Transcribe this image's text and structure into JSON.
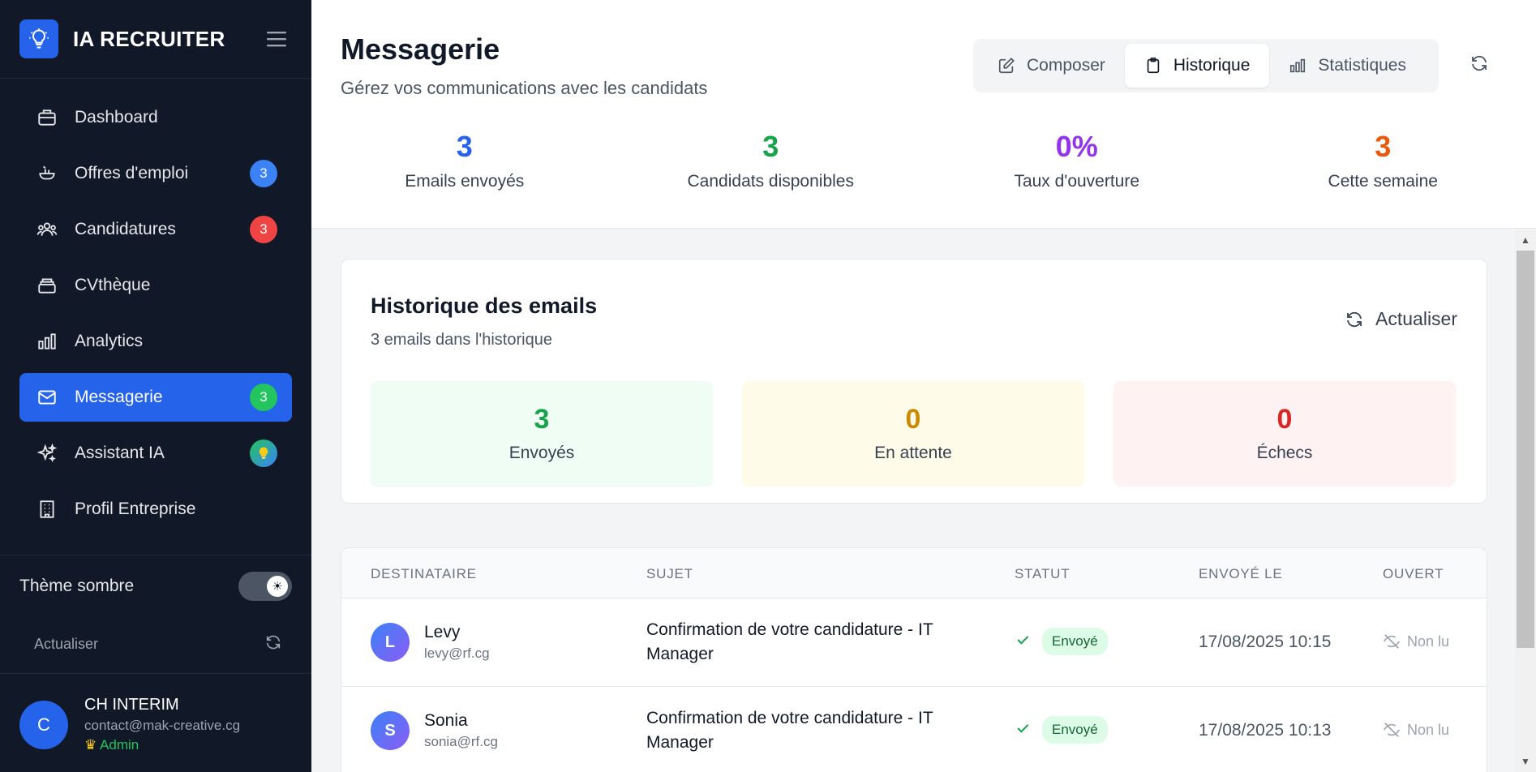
{
  "brand": {
    "name": "IA RECRUITER"
  },
  "sidebar": {
    "items": [
      {
        "label": "Dashboard",
        "icon": "briefcase-icon"
      },
      {
        "label": "Offres d'emploi",
        "icon": "pan-icon",
        "badge": "3",
        "badge_color": "#3b82f6"
      },
      {
        "label": "Candidatures",
        "icon": "users-icon",
        "badge": "3",
        "badge_color": "#ef4444"
      },
      {
        "label": "CVthèque",
        "icon": "archive-icon"
      },
      {
        "label": "Analytics",
        "icon": "bar-chart-icon"
      },
      {
        "label": "Messagerie",
        "icon": "mail-icon",
        "badge": "3",
        "badge_color": "#22c55e",
        "active": true
      },
      {
        "label": "Assistant IA",
        "icon": "sparkles-icon",
        "badge_icon": "lightbulb-icon"
      },
      {
        "label": "Profil Entreprise",
        "icon": "building-icon"
      }
    ],
    "theme_label": "Thème sombre",
    "refresh_label": "Actualiser",
    "user": {
      "initial": "C",
      "name": "CH INTERIM",
      "email": "contact@mak-creative.cg",
      "role": "Admin"
    }
  },
  "header": {
    "title": "Messagerie",
    "subtitle": "Gérez vos communications avec les candidats",
    "tabs": [
      {
        "label": "Composer",
        "icon": "edit-icon"
      },
      {
        "label": "Historique",
        "icon": "clipboard-icon",
        "active": true
      },
      {
        "label": "Statistiques",
        "icon": "bar-chart-icon"
      }
    ],
    "stats": [
      {
        "value": "3",
        "label": "Emails envoyés",
        "color": "#2563eb"
      },
      {
        "value": "3",
        "label": "Candidats disponibles",
        "color": "#16a34a"
      },
      {
        "value": "0%",
        "label": "Taux d'ouverture",
        "color": "#9333ea"
      },
      {
        "value": "3",
        "label": "Cette semaine",
        "color": "#ea580c"
      }
    ]
  },
  "history": {
    "title": "Historique des emails",
    "subtitle": "3 emails dans l'historique",
    "refresh_label": "Actualiser",
    "summary": [
      {
        "value": "3",
        "label": "Envoyés",
        "color": "#16a34a",
        "bg": "#f0fdf4"
      },
      {
        "value": "0",
        "label": "En attente",
        "color": "#ca8a04",
        "bg": "#fefce8"
      },
      {
        "value": "0",
        "label": "Échecs",
        "color": "#dc2626",
        "bg": "#fef2f2"
      }
    ]
  },
  "table": {
    "headers": [
      "DESTINATAIRE",
      "SUJET",
      "STATUT",
      "ENVOYÉ LE",
      "OUVERT"
    ],
    "rows": [
      {
        "initial": "L",
        "name": "Levy",
        "email": "levy@rf.cg",
        "subject": "Confirmation de votre candidature - IT Manager",
        "status": "Envoyé",
        "date": "17/08/2025 10:15",
        "opened": "Non lu"
      },
      {
        "initial": "S",
        "name": "Sonia",
        "email": "sonia@rf.cg",
        "subject": "Confirmation de votre candidature - IT Manager",
        "status": "Envoyé",
        "date": "17/08/2025 10:13",
        "opened": "Non lu"
      }
    ]
  }
}
